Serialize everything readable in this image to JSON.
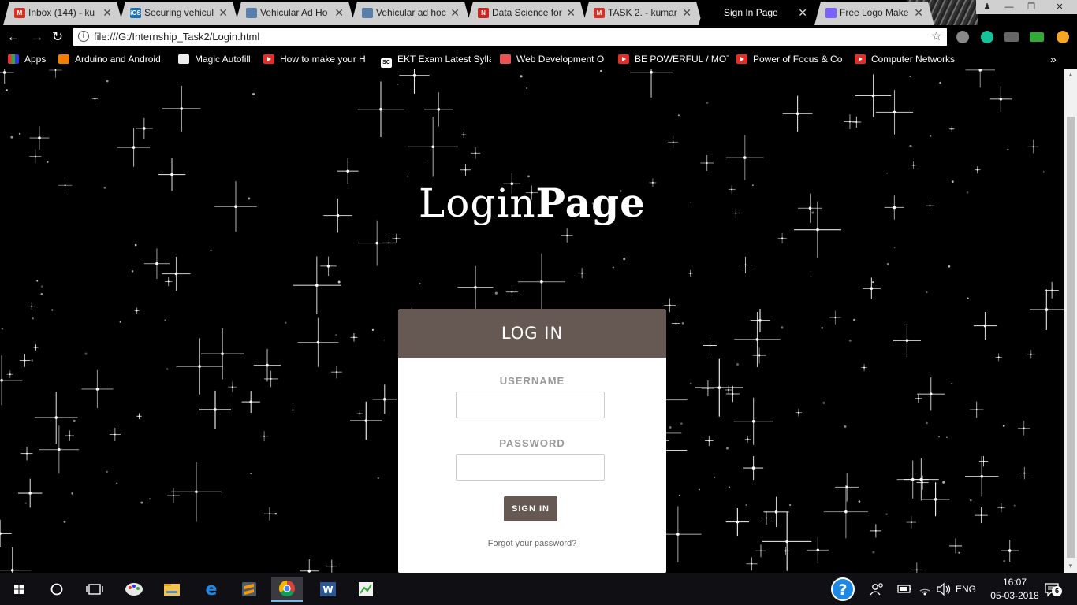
{
  "browser": {
    "tabs": [
      {
        "label": "Inbox (144) - ku",
        "icon": "gmail-icon"
      },
      {
        "label": "Securing vehicul",
        "icon": "ios-icon",
        "icon_text": "iOS"
      },
      {
        "label": "Vehicular Ad Ho",
        "icon": "document-icon"
      },
      {
        "label": "Vehicular ad hoc",
        "icon": "document-icon"
      },
      {
        "label": "Data Science for",
        "icon": "n-icon",
        "icon_text": "N"
      },
      {
        "label": "TASK 2. - kumar",
        "icon": "gmail-icon"
      },
      {
        "label": "Sign In Page",
        "icon": "none"
      },
      {
        "label": "Free Logo Make",
        "icon": "logo-maker-icon"
      }
    ],
    "active_tab_index": 6,
    "close_glyph": "✕",
    "url": "file:///G:/Internship_Task2/Login.html",
    "bookmarks": [
      {
        "label": "Apps",
        "icon": "apps-grid-icon"
      },
      {
        "label": "Arduino and Android",
        "icon": "blogger-icon"
      },
      {
        "label": "Magic Autofill",
        "icon": "page-icon"
      },
      {
        "label": "How to make your H",
        "icon": "youtube-icon"
      },
      {
        "label": "EKT Exam Latest Sylla",
        "icon": "sc-icon",
        "icon_text": "SC"
      },
      {
        "label": "Web Development O",
        "icon": "udemy-icon"
      },
      {
        "label": "BE POWERFUL / MOT",
        "icon": "youtube-icon"
      },
      {
        "label": "Power of Focus & Co",
        "icon": "youtube-icon"
      },
      {
        "label": "Computer Networks",
        "icon": "youtube-icon"
      }
    ],
    "more_bookmarks": "»"
  },
  "page": {
    "heading_light": "Login",
    "heading_bold": "Page",
    "card_title": "LOG IN",
    "username_label": "USERNAME",
    "username_value": "",
    "password_label": "PASSWORD",
    "password_value": "",
    "signin_label": "SIGN IN",
    "forgot_label": "Forgot your password?"
  },
  "taskbar": {
    "apps": [
      "start-icon",
      "cortana-icon",
      "task-view-icon",
      "paint-icon",
      "file-explorer-icon",
      "edge-icon",
      "sublime-icon",
      "chrome-icon",
      "word-icon",
      "notepadpp-icon"
    ],
    "active_app": "chrome-icon",
    "language": "ENG",
    "time": "16:07",
    "date": "05-03-2018",
    "notification_count": "6"
  },
  "colors": {
    "card_accent": "#665953",
    "page_background": "#000000",
    "taskbar": "#101014"
  }
}
